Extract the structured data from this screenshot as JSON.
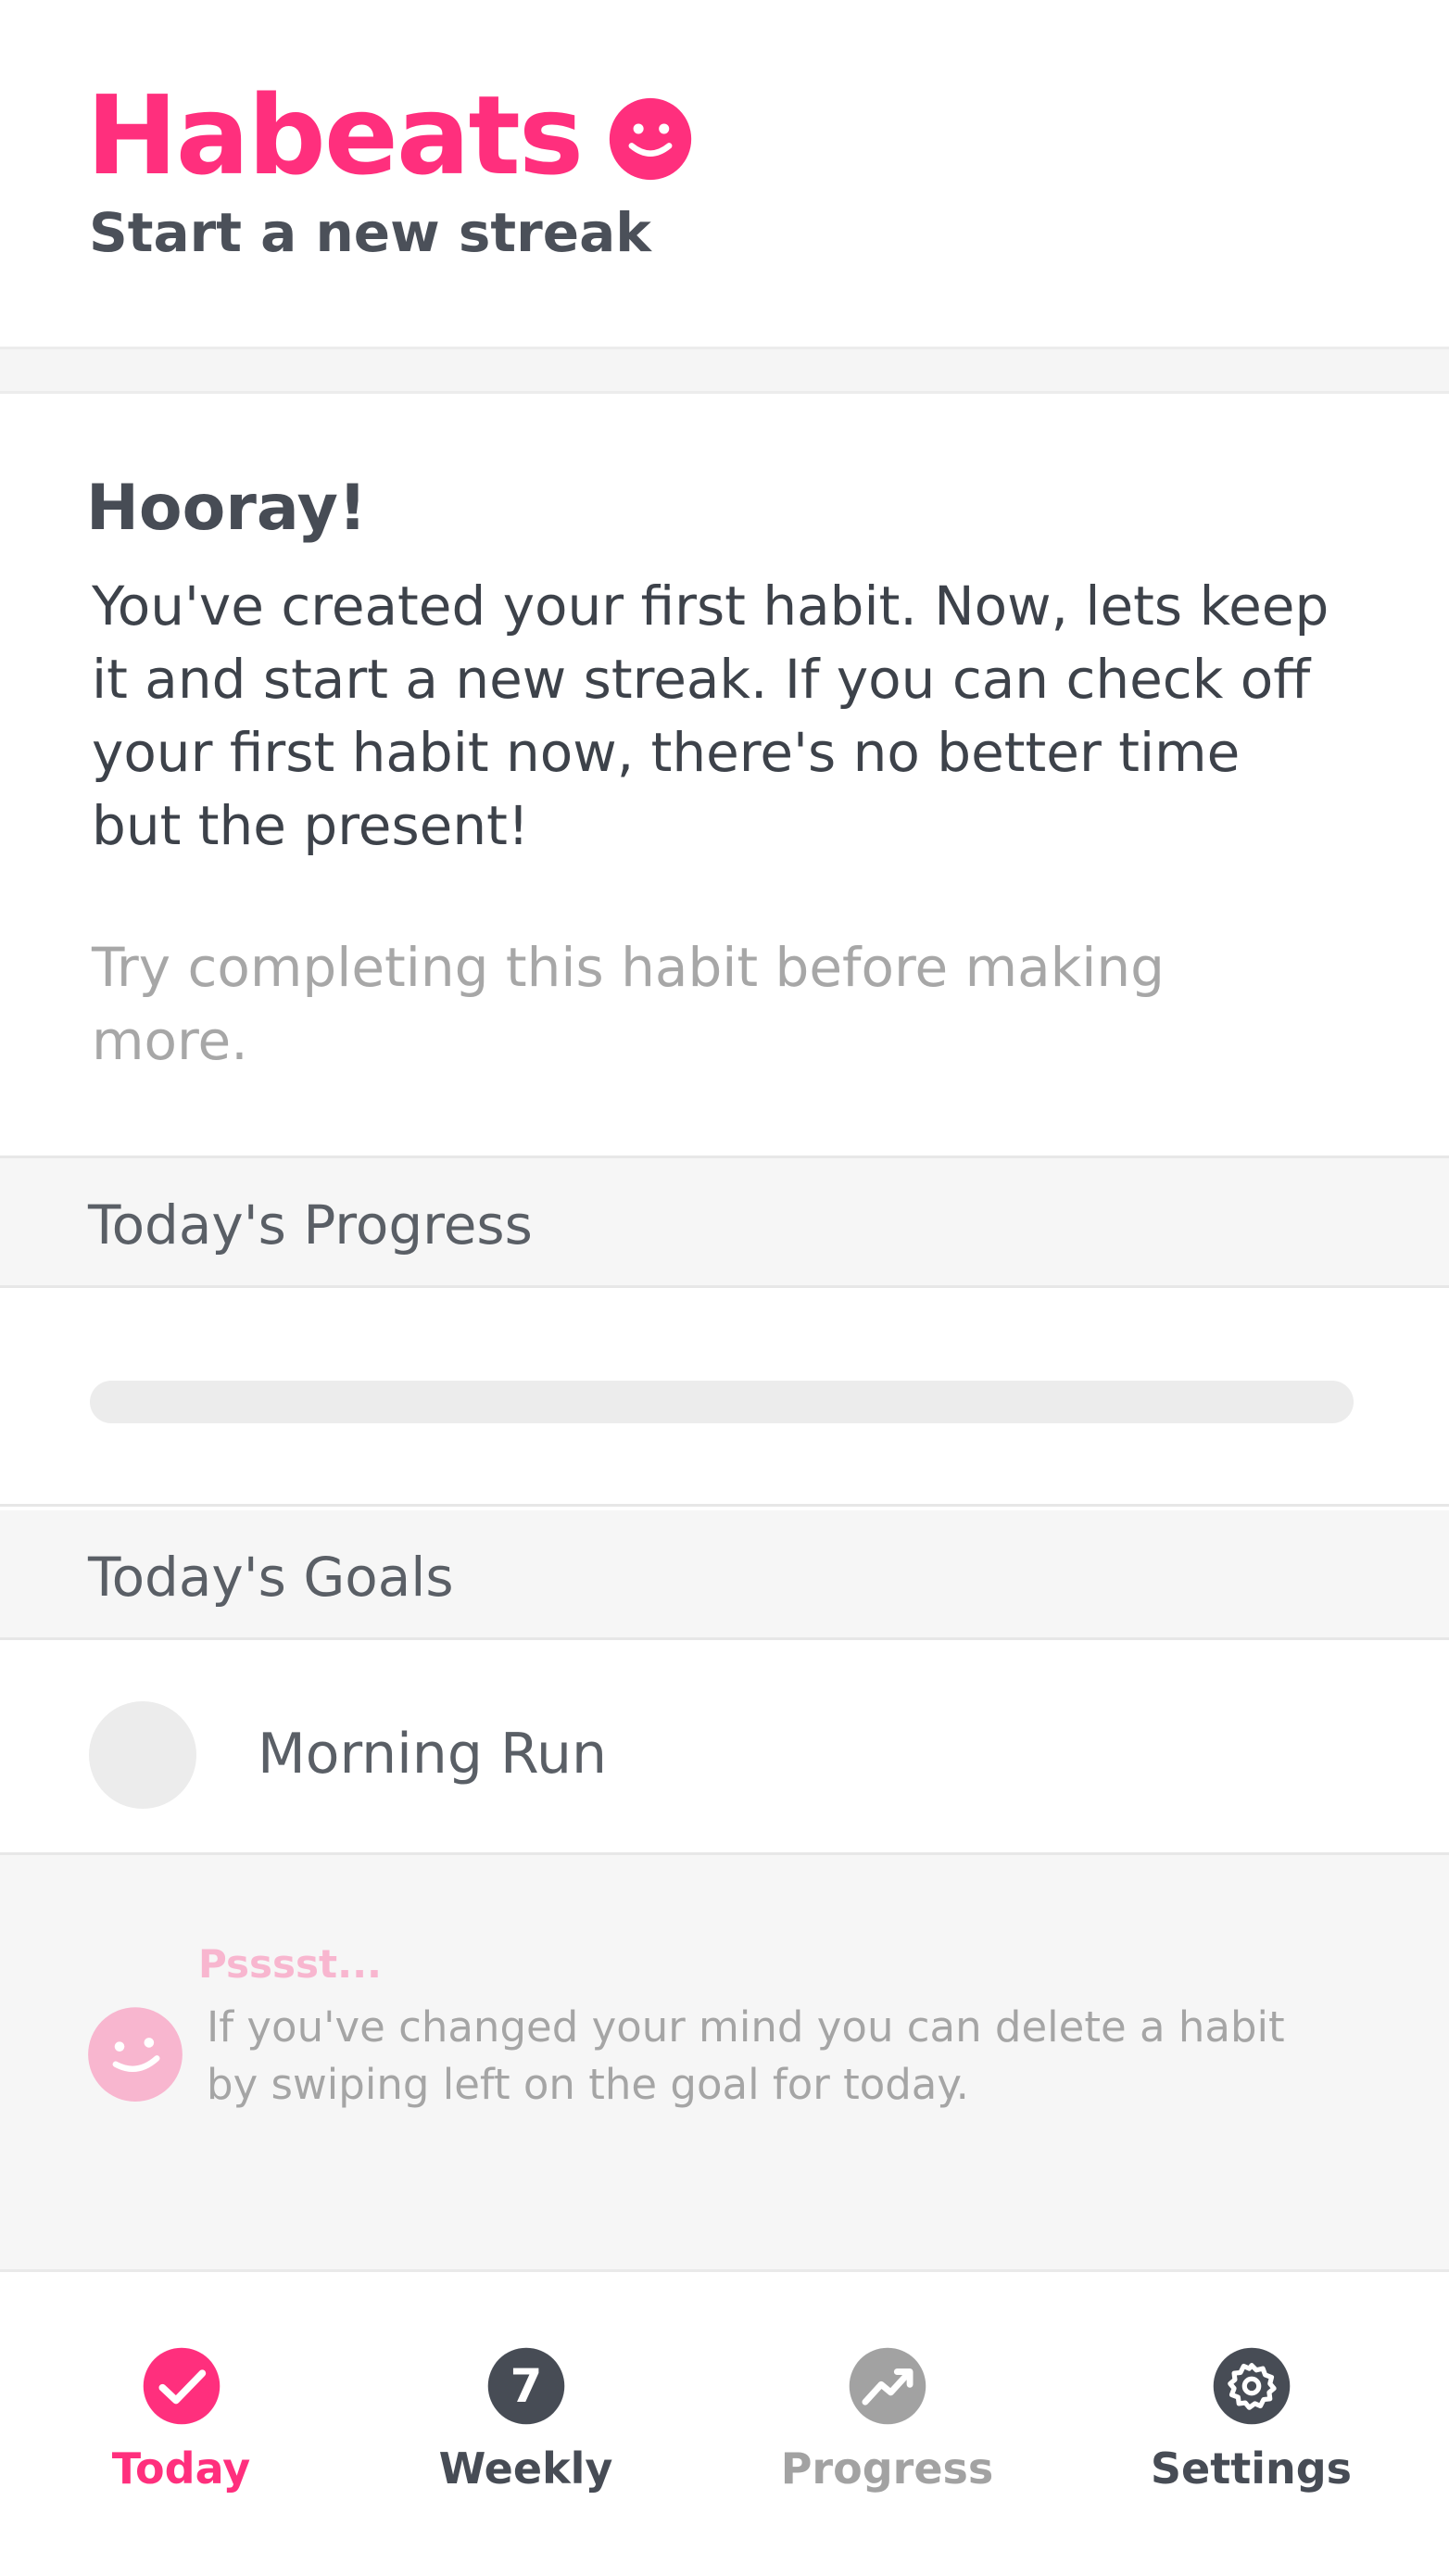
{
  "header": {
    "app_name": "Habeats",
    "subtitle": "Start a new streak",
    "logo_icon": "smiley-face-icon"
  },
  "intro": {
    "heading": "Hooray!",
    "body": "You've created your first habit. Now, lets keep it and start a new streak. If you can check off your first habit now, there's no better time but the present!",
    "hint": "Try completing this habit before making more."
  },
  "progress_section": {
    "label": "Today's Progress",
    "value_percent": 0
  },
  "goals_section": {
    "label": "Today's Goals",
    "items": [
      {
        "label": "Morning Run",
        "completed": false
      }
    ]
  },
  "tip": {
    "title": "Psssst...",
    "text": "If you've changed your mind you can delete a habit by swiping left on the goal for today.",
    "icon": "smiley-face-icon"
  },
  "tabs": [
    {
      "label": "Today",
      "icon": "checkmark-icon",
      "active": true
    },
    {
      "label": "Weekly",
      "icon": "seven-badge-icon",
      "badge": "7",
      "active": false
    },
    {
      "label": "Progress",
      "icon": "trend-up-icon",
      "active": false
    },
    {
      "label": "Settings",
      "icon": "gear-icon",
      "active": false
    }
  ],
  "colors": {
    "brand": "#ff2f7d",
    "brand_light": "#f8b6cf",
    "text_dark": "#4a4f57",
    "text_muted": "#a7a7a7",
    "tab_inactive": "#474c55",
    "tab_disabled": "#a2a2a2"
  }
}
